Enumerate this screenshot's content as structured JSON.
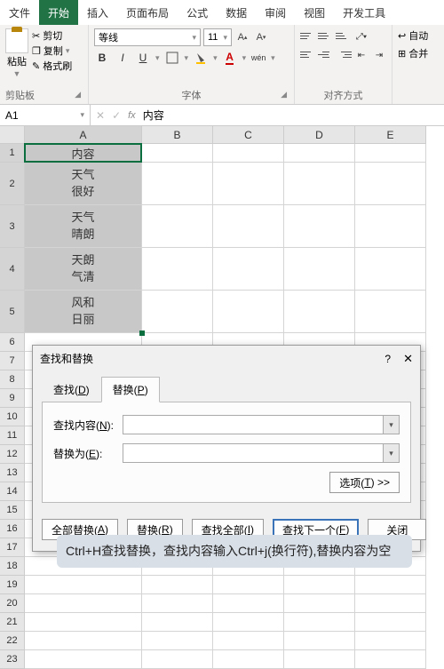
{
  "tabs": {
    "file": "文件",
    "home": "开始",
    "insert": "插入",
    "layout": "页面布局",
    "formulas": "公式",
    "data": "数据",
    "review": "审阅",
    "view": "视图",
    "dev": "开发工具"
  },
  "ribbon": {
    "paste": "粘贴",
    "cut": "剪切",
    "copy": "复制",
    "fmtpaint": "格式刷",
    "clipboard_label": "剪贴板",
    "font_label": "字体",
    "align_label": "对齐方式",
    "fontname": "等线",
    "fontsize": "11",
    "bold": "B",
    "italic": "I",
    "underline": "U",
    "wen": "wén",
    "auto": "自动",
    "merge": "合并"
  },
  "namebox": "A1",
  "formula_value": "内容",
  "cols": {
    "A": "A",
    "B": "B",
    "C": "C",
    "D": "D",
    "E": "E"
  },
  "cells": {
    "A1": "内容",
    "A2a": "天气",
    "A2b": "很好",
    "A3a": "天气",
    "A3b": "晴朗",
    "A4a": "天朗",
    "A4b": "气清",
    "A5a": "风和",
    "A5b": "日丽"
  },
  "dialog": {
    "title": "查找和替换",
    "tab_find": "查找(D)",
    "tab_replace": "替换(P)",
    "find_label": "查找内容(N):",
    "replace_label": "替换为(E):",
    "options": "选项(T) >>",
    "btn_replace_all": "全部替换(A)",
    "btn_replace": "替换(R)",
    "btn_find_all": "查找全部(I)",
    "btn_find_next": "查找下一个(F)",
    "btn_close": "关闭",
    "help": "?",
    "close_x": "✕"
  },
  "note": "Ctrl+H查找替换，查找内容输入Ctrl+j(换行符),替换内容为空"
}
